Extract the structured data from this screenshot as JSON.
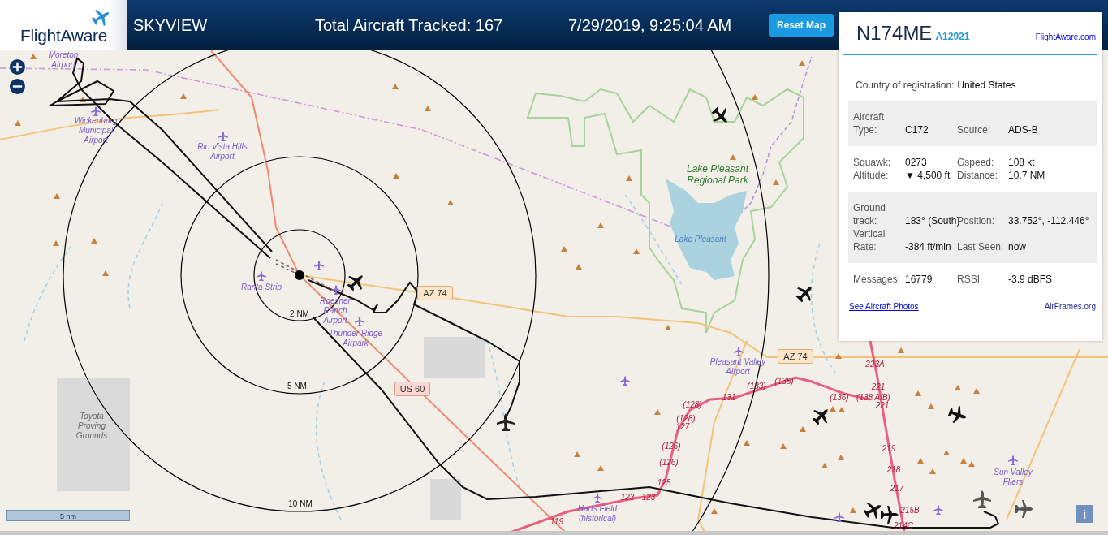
{
  "header": {
    "logo": "FlightAware",
    "title": "SKYVIEW",
    "aircraft_count": "Total Aircraft Tracked: 167",
    "timestamp": "7/29/2019, 9:25:04 AM",
    "reset_button": "Reset Map"
  },
  "info_panel": {
    "registration": "N174ME",
    "hex": "A12921",
    "site_link": "FlightAware.com",
    "country": {
      "label": "Country of registration:",
      "value": "United States"
    },
    "sections": [
      {
        "shaded": true,
        "rows": [
          [
            {
              "label": "Aircraft Type:",
              "value": "C172"
            },
            {
              "label": "Source:",
              "value": "ADS-B"
            }
          ]
        ]
      },
      {
        "shaded": false,
        "rows": [
          [
            {
              "label": "Squawk:",
              "value": "0273"
            },
            {
              "label": "Gspeed:",
              "value": "108 kt"
            }
          ],
          [
            {
              "label": "Altitude:",
              "value": "▼ 4,500 ft"
            },
            {
              "label": "Distance:",
              "value": "10.7 NM"
            }
          ]
        ]
      },
      {
        "shaded": true,
        "rows": [
          [
            {
              "label": "Ground track:",
              "value": "183° (South)"
            },
            {
              "label": "Position:",
              "value": "33.752°, -112.446°"
            }
          ],
          [
            {
              "label": "Vertical Rate:",
              "value": "-384 ft/min"
            },
            {
              "label": "Last Seen:",
              "value": "now"
            }
          ]
        ]
      },
      {
        "shaded": false,
        "rows": [
          [
            {
              "label": "Messages:",
              "value": "16779"
            },
            {
              "label": "RSSI:",
              "value": "-3.9 dBFS"
            }
          ]
        ]
      }
    ],
    "photos_link": "See Aircraft Photos",
    "airframes_link": "AirFrames.org"
  },
  "map": {
    "places": [
      {
        "name": "Moreton Airport",
        "kind": "airport"
      },
      {
        "name": "Wickenburg Municipal Airport",
        "kind": "airport"
      },
      {
        "name": "Rio Vista Hills Airport",
        "kind": "airport"
      },
      {
        "name": "Ranta Strip",
        "kind": "airport"
      },
      {
        "name": "Roesner Ranch Airport",
        "kind": "airport"
      },
      {
        "name": "Thunder Ridge Airpark",
        "kind": "airport"
      },
      {
        "name": "Toyota Proving Grounds",
        "kind": "area"
      },
      {
        "name": "Lake Pleasant Regional Park",
        "kind": "park"
      },
      {
        "name": "Lake Pleasant",
        "kind": "water"
      },
      {
        "name": "Pleasant Valley Airport",
        "kind": "airport"
      },
      {
        "name": "Harts Field (historical)",
        "kind": "airport"
      },
      {
        "name": "Sun Valley Fliers",
        "kind": "airport"
      }
    ],
    "road_shields": [
      {
        "label": "AZ 74",
        "kind": "state"
      },
      {
        "label": "AZ 74",
        "kind": "state"
      },
      {
        "label": "US 60",
        "kind": "us"
      }
    ],
    "range_rings": [
      "2 NM",
      "5 NM",
      "10 NM"
    ],
    "exits": [
      "223A",
      "(135)",
      "(133)",
      "221",
      "131",
      "(136)",
      "(138 A/B)",
      "(128)",
      "221",
      "(128)",
      "127",
      "(126)",
      "219",
      "(126)",
      "218",
      "125",
      "217",
      "123",
      "123",
      "215B",
      "119",
      "214C"
    ],
    "scale": "5 nm",
    "info_button": "i"
  }
}
